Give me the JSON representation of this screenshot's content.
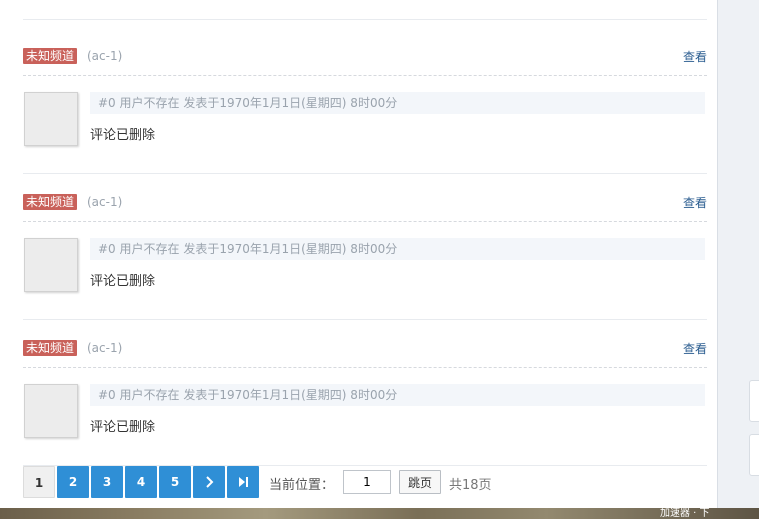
{
  "items": [
    {
      "badge": "未知频道",
      "tag": "(ac-1)",
      "view_label": "查看",
      "meta": "#0 用户不存在 发表于1970年1月1日(星期四) 8时00分",
      "text": "评论已删除"
    },
    {
      "badge": "未知频道",
      "tag": "(ac-1)",
      "view_label": "查看",
      "meta": "#0 用户不存在 发表于1970年1月1日(星期四) 8时00分",
      "text": "评论已删除"
    },
    {
      "badge": "未知频道",
      "tag": "(ac-1)",
      "view_label": "查看",
      "meta": "#0 用户不存在 发表于1970年1月1日(星期四) 8时00分",
      "text": "评论已删除"
    }
  ],
  "pager": {
    "pages": [
      "1",
      "2",
      "3",
      "4",
      "5"
    ],
    "current": "1",
    "next_icon": "chevron-right-icon",
    "last_icon": "skip-to-end-icon",
    "position_label": "当前位置：",
    "input_value": "1",
    "jump_label": "跳页",
    "total_label": "共18页"
  },
  "bottom_strip_text": "加速器 · 下",
  "colors": {
    "badge": "#c9615a",
    "link": "#2b5d90",
    "pager_active": "#2f8fd6",
    "meta_bg": "#f3f6fa"
  }
}
